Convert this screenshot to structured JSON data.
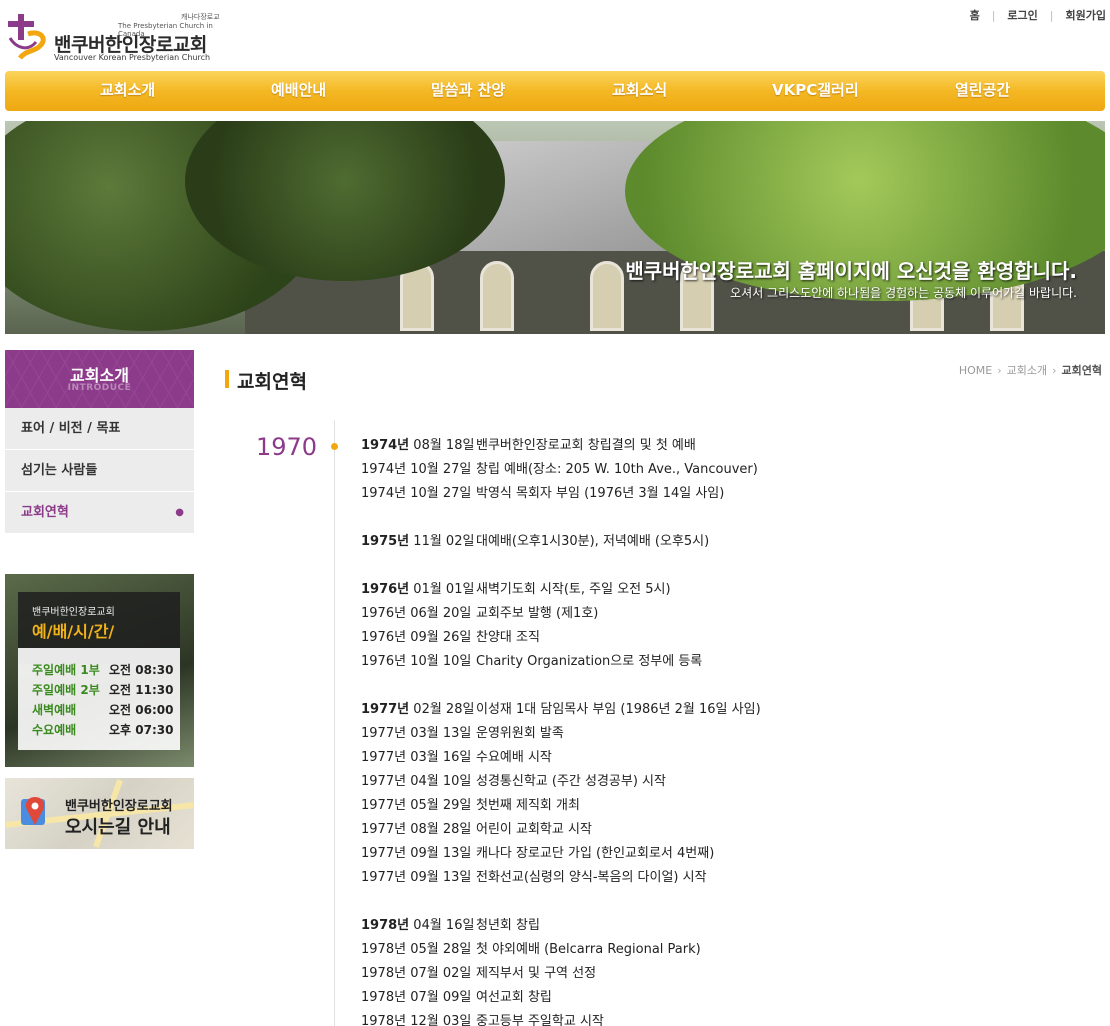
{
  "header": {
    "logo": {
      "denomination_kr": "캐나다장로교",
      "denomination_en": "The Presbyterian Church in Canada",
      "name_kr": "밴쿠버한인장로교회",
      "name_en": "Vancouver Korean Presbyterian Church"
    },
    "top_links": [
      "홈",
      "로그인",
      "회원가입"
    ]
  },
  "nav": [
    "교회소개",
    "예배안내",
    "말씀과 찬양",
    "교회소식",
    "VKPC갤러리",
    "열린공간"
  ],
  "banner": {
    "title": "밴쿠버한인장로교회 홈페이지에 오신것을 환영합니다.",
    "subtitle": "오셔서 그리스도안에 하나됨을 경험하는 공동체 이루어가길 바랍니다."
  },
  "sidebar": {
    "title": "교회소개",
    "title_en": "INTRODUCE",
    "items": [
      {
        "label": "표어 / 비전 / 목표",
        "active": false
      },
      {
        "label": "섬기는 사람들",
        "active": false
      },
      {
        "label": "교회연혁",
        "active": true
      }
    ],
    "worship": {
      "church": "밴쿠버한인장로교회",
      "title": "예/배/시/간/",
      "services": [
        {
          "label": "주일예배 1부",
          "time": "오전 08:30"
        },
        {
          "label": "주일예배 2부",
          "time": "오전 11:30"
        },
        {
          "label": "새벽예배",
          "time": "오전 06:00"
        },
        {
          "label": "수요예배",
          "time": "오후 07:30"
        }
      ]
    },
    "map_banner": {
      "line1": "밴쿠버한인장로교회",
      "line2": "오시는길 안내"
    }
  },
  "content": {
    "page_title": "교회연혁",
    "breadcrumb": [
      "HOME",
      "교회소개",
      "교회연혁"
    ],
    "decade": "1970",
    "events": [
      {
        "year": "1974년",
        "date": "08월 18일",
        "text": "밴쿠버한인장로교회 창립결의 및 첫 예배",
        "first": true,
        "gap": false
      },
      {
        "year": "1974년",
        "date": "10월 27일",
        "text": "창립 예배(장소: 205 W. 10th Ave., Vancouver)",
        "first": false,
        "gap": false
      },
      {
        "year": "1974년",
        "date": "10월 27일",
        "text": "박영식 목회자 부임 (1976년 3월 14일 사임)",
        "first": false,
        "gap": false
      },
      {
        "year": "1975년",
        "date": "11월 02일",
        "text": "대예배(오후1시30분), 저녁예배 (오후5시)",
        "first": true,
        "gap": true
      },
      {
        "year": "1976년",
        "date": "01월 01일",
        "text": "새벽기도회 시작(토, 주일 오전 5시)",
        "first": true,
        "gap": true
      },
      {
        "year": "1976년",
        "date": "06월 20일",
        "text": "교회주보 발행 (제1호)",
        "first": false,
        "gap": false
      },
      {
        "year": "1976년",
        "date": "09월 26일",
        "text": "찬양대 조직",
        "first": false,
        "gap": false
      },
      {
        "year": "1976년",
        "date": "10월 10일",
        "text": "Charity Organization으로 정부에 등록",
        "first": false,
        "gap": false
      },
      {
        "year": "1977년",
        "date": "02월 28일",
        "text": "이성재 1대 담임목사 부임 (1986년 2월 16일 사임)",
        "first": true,
        "gap": true
      },
      {
        "year": "1977년",
        "date": "03월 13일",
        "text": "운영위원회 발족",
        "first": false,
        "gap": false
      },
      {
        "year": "1977년",
        "date": "03월 16일",
        "text": "수요예배 시작",
        "first": false,
        "gap": false
      },
      {
        "year": "1977년",
        "date": "04월 10일",
        "text": "성경통신학교 (주간 성경공부) 시작",
        "first": false,
        "gap": false
      },
      {
        "year": "1977년",
        "date": "05월 29일",
        "text": "첫번째 제직회 개최",
        "first": false,
        "gap": false
      },
      {
        "year": "1977년",
        "date": "08월 28일",
        "text": "어린이 교회학교 시작",
        "first": false,
        "gap": false
      },
      {
        "year": "1977년",
        "date": "09월 13일",
        "text": "캐나다 장로교단 가입 (한인교회로서 4번째)",
        "first": false,
        "gap": false
      },
      {
        "year": "1977년",
        "date": "09월 13일",
        "text": "전화선교(심령의 양식-복음의 다이얼) 시작",
        "first": false,
        "gap": false
      },
      {
        "year": "1978년",
        "date": "04월 16일",
        "text": "청년회 창립",
        "first": true,
        "gap": true
      },
      {
        "year": "1978년",
        "date": "05월 28일",
        "text": "첫 야외예배 (Belcarra Regional Park)",
        "first": false,
        "gap": false
      },
      {
        "year": "1978년",
        "date": "07월 02일",
        "text": "제직부서 및 구역 선정",
        "first": false,
        "gap": false
      },
      {
        "year": "1978년",
        "date": "07월 09일",
        "text": "여선교회 창립",
        "first": false,
        "gap": false
      },
      {
        "year": "1978년",
        "date": "12월 03일",
        "text": "중고등부 주일학교 시작",
        "first": false,
        "gap": false
      }
    ]
  },
  "colors": {
    "accent_purple": "#8c3b8a",
    "nav_gold": "#f4b824",
    "worship_green": "#3a8a1f"
  }
}
